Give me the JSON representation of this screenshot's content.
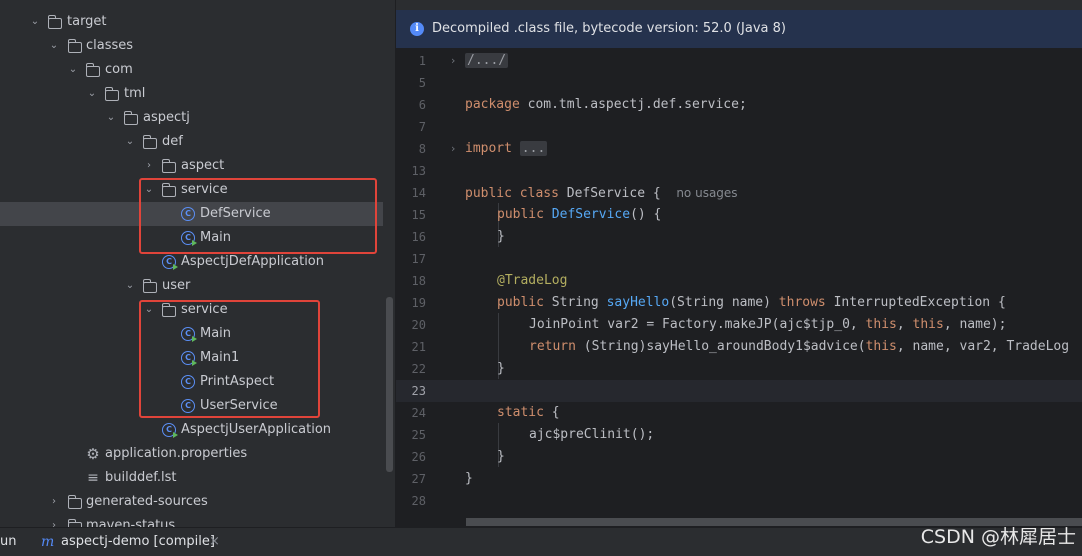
{
  "tree": {
    "items": [
      {
        "label": "target"
      },
      {
        "label": "classes"
      },
      {
        "label": "com"
      },
      {
        "label": "tml"
      },
      {
        "label": "aspectj"
      },
      {
        "label": "def"
      },
      {
        "label": "aspect"
      },
      {
        "label": "service"
      },
      {
        "label": "DefService"
      },
      {
        "label": "Main"
      },
      {
        "label": "AspectjDefApplication"
      },
      {
        "label": "user"
      },
      {
        "label": "service"
      },
      {
        "label": "Main"
      },
      {
        "label": "Main1"
      },
      {
        "label": "PrintAspect"
      },
      {
        "label": "UserService"
      },
      {
        "label": "AspectjUserApplication"
      },
      {
        "label": "application.properties"
      },
      {
        "label": "builddef.lst"
      },
      {
        "label": "generated-sources"
      },
      {
        "label": "maven-status"
      }
    ]
  },
  "editor": {
    "banner": "Decompiled .class file, bytecode version: 52.0 (Java 8)",
    "line_numbers": [
      "1",
      "5",
      "6",
      "7",
      "8",
      "13",
      "14",
      "15",
      "16",
      "17",
      "18",
      "19",
      "20",
      "21",
      "22",
      "23",
      "24",
      "25",
      "26",
      "27",
      "28"
    ],
    "code": {
      "l1": "/.../",
      "l6_kw": "package",
      "l6_rest": " com.tml.aspectj.def.service;",
      "l8_kw": "import",
      "l8_collapsed": "...",
      "l14_kw": "public class",
      "l14_rest": " DefService { ",
      "l14_hint": "no usages",
      "l15_kw": "public",
      "l15_fn": "DefService",
      "l15_rest": "() {",
      "l16": "}",
      "l18_an": "@TradeLog",
      "l19_kw": "public",
      "l19_a": " String ",
      "l19_fn": "sayHello",
      "l19_b": "(String name) ",
      "l19_kw2": "throws",
      "l19_c": " InterruptedException {",
      "l20_a": "JoinPoint var2 = Factory.makeJP(ajc$tjp_0, ",
      "l20_kw": "this",
      "l20_b": ", ",
      "l20_kw2": "this",
      "l20_c": ", name);",
      "l21_kw": "return",
      "l21_a": " (String)sayHello_aroundBody1$advice(",
      "l21_kw2": "this",
      "l21_b": ", name, var2, TradeLog",
      "l22": "}",
      "l24_kw": "static",
      "l24_rest": " {",
      "l25": "ajc$preClinit();",
      "l26": "}",
      "l27": "}"
    }
  },
  "bottom": {
    "run_label": "un",
    "tab_icon": "m",
    "tab_label": "aspectj-demo [compile]",
    "close": "×"
  },
  "watermark": "CSDN @林犀居士"
}
